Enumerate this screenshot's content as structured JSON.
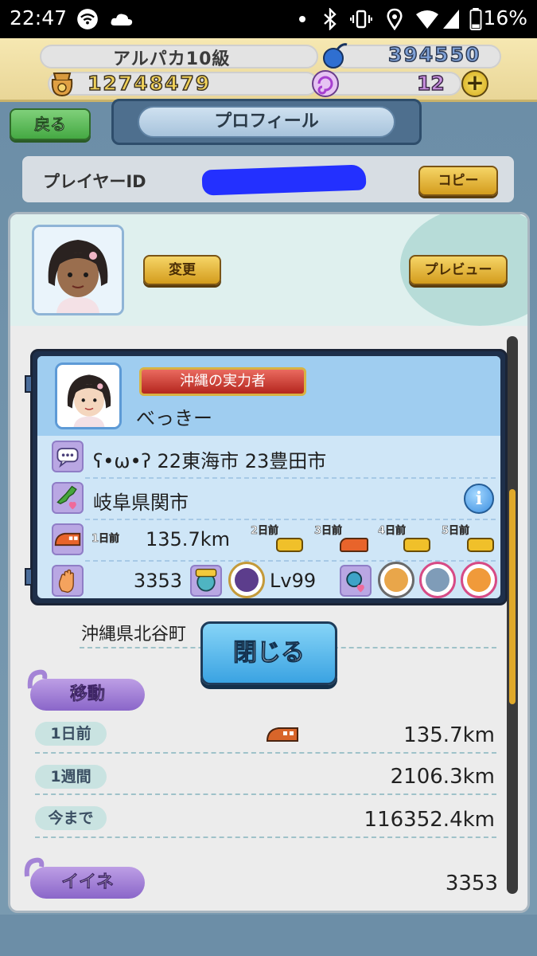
{
  "status_bar": {
    "time": "22:47",
    "battery_percent": "16%"
  },
  "currency": {
    "rank_label": "アルパカ10級",
    "blue_points": "394550",
    "coins": "12748479",
    "tickets": "12",
    "add_symbol": "+"
  },
  "nav": {
    "back_label": "戻る",
    "title": "プロフィール"
  },
  "player_id": {
    "label": "プレイヤーID",
    "copy_label": "コピー"
  },
  "profile": {
    "change_label": "変更",
    "preview_label": "プレビュー"
  },
  "popup": {
    "title_badge": "沖縄の実力者",
    "name": "べっきー",
    "comment": "ʕ•ω•ʔ 22東海市 23豊田市",
    "location": "岐阜県関市",
    "info_symbol": "i",
    "distance_day1_label": "1日前",
    "distance_value": "135.7km",
    "history_labels": [
      "2日前",
      "3日前",
      "4日前",
      "5日前"
    ],
    "likes": "3353",
    "level": "Lv99"
  },
  "close_label": "閉じる",
  "home_location": "沖縄県北谷町",
  "movement": {
    "section_label": "移動",
    "rows": [
      {
        "label": "1日前",
        "value": "135.7km"
      },
      {
        "label": "1週間",
        "value": "2106.3km"
      },
      {
        "label": "今まで",
        "value": "116352.4km"
      }
    ]
  },
  "likes_section": {
    "label": "イイネ",
    "value": "3353"
  }
}
